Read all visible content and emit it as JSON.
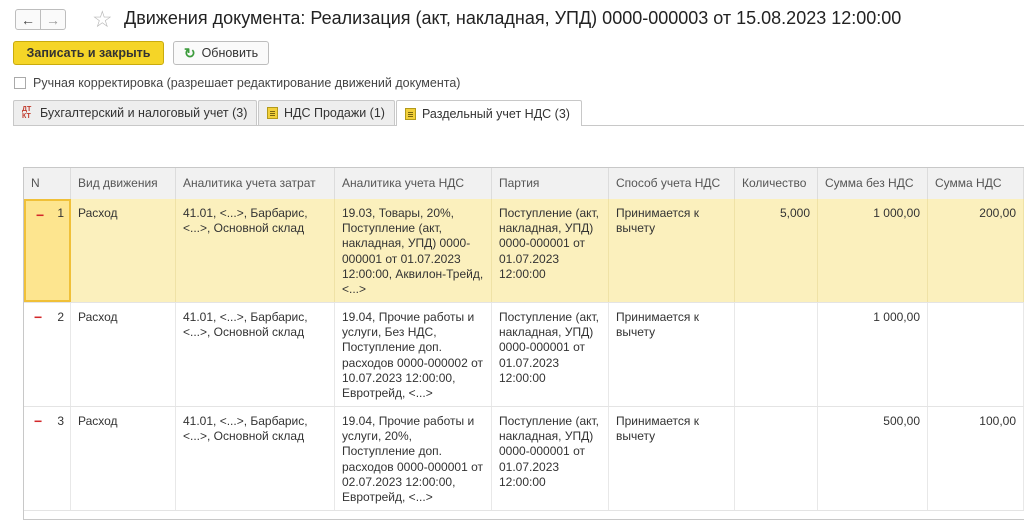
{
  "window": {
    "title": "Движения документа: Реализация (акт, накладная, УПД) 0000-000003 от 15.08.2023 12:00:00",
    "back_glyph": "←",
    "forward_glyph": "→",
    "star_glyph": "☆"
  },
  "toolbar": {
    "save_close_label": "Записать и закрыть",
    "refresh_label": "Обновить",
    "refresh_glyph": "↻"
  },
  "manual_adjust": {
    "label": "Ручная корректировка (разрешает редактирование движений документа)",
    "checked": false
  },
  "tabs": [
    {
      "label": "Бухгалтерский и налоговый учет (3)",
      "icon": "dt-kt-icon",
      "icon_text": "ДТ\nКТ"
    },
    {
      "label": "НДС Продажи (1)",
      "icon": "register-icon"
    },
    {
      "label": "Раздельный учет НДС (3)",
      "icon": "register-icon",
      "active": true
    }
  ],
  "table": {
    "columns": [
      "N",
      "Вид движения",
      "Аналитика учета затрат",
      "Аналитика учета НДС",
      "Партия",
      "Способ учета НДС",
      "Количество",
      "Сумма без НДС",
      "Сумма НДС"
    ],
    "rows": [
      {
        "n": "1",
        "movement": "Расход",
        "cost": "41.01, <...>, Барбарис, <...>, Основной склад",
        "vat": "19.03, Товары, 20%, Поступление (акт, накладная, УПД) 0000-000001 от 01.07.2023 12:00:00, Аквилон-Трейд, <...>",
        "batch": "Поступление (акт, накладная, УПД) 0000-000001 от 01.07.2023 12:00:00",
        "method": "Принимается к вычету",
        "qty": "5,000",
        "sum_no_vat": "1 000,00",
        "vat_sum": "200,00",
        "selected": true
      },
      {
        "n": "2",
        "movement": "Расход",
        "cost": "41.01, <...>, Барбарис, <...>, Основной склад",
        "vat": "19.04, Прочие работы и услуги, Без НДС, Поступление доп. расходов 0000-000002 от 10.07.2023 12:00:00, Евротрейд, <...>",
        "batch": "Поступление (акт, накладная, УПД) 0000-000001 от 01.07.2023 12:00:00",
        "method": "Принимается к вычету",
        "qty": "",
        "sum_no_vat": "1 000,00",
        "vat_sum": "",
        "selected": false
      },
      {
        "n": "3",
        "movement": "Расход",
        "cost": "41.01, <...>, Барбарис, <...>, Основной склад",
        "vat": "19.04, Прочие работы и услуги, 20%, Поступление доп. расходов 0000-000001 от 02.07.2023 12:00:00, Евротрейд, <...>",
        "batch": "Поступление (акт, накладная, УПД) 0000-000001 от 01.07.2023 12:00:00",
        "method": "Принимается к вычету",
        "qty": "",
        "sum_no_vat": "500,00",
        "vat_sum": "100,00",
        "selected": false
      }
    ]
  }
}
